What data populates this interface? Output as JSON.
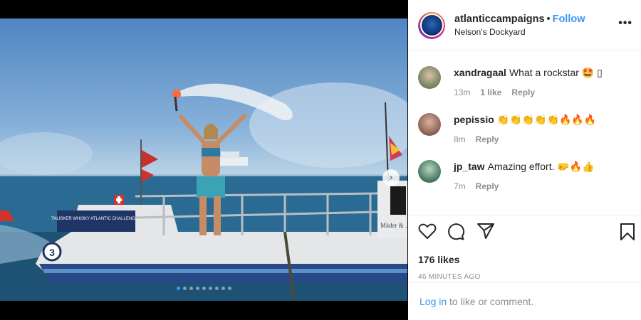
{
  "post": {
    "username": "atlanticcampaigns",
    "separator": "•",
    "follow_label": "Follow",
    "location": "Nelson's Dockyard",
    "more_label": "•••"
  },
  "media": {
    "boat_number": "3",
    "boat_text_left": "TALISKER WHISKY ATLANTIC CHALLENGE",
    "boat_text_right": "Mäder & ...",
    "carousel_next_icon": "chevron-right-icon",
    "slide_count": 9,
    "active_slide": 1
  },
  "comments": [
    {
      "user": "xandragaal",
      "text": "What a rockstar 🤩 ▯",
      "age": "13m",
      "likes": "1 like",
      "reply": "Reply"
    },
    {
      "user": "pepissio",
      "text": "👏👏👏👏👏🔥🔥🔥",
      "age": "8m",
      "reply": "Reply"
    },
    {
      "user": "jp_taw",
      "text": "Amazing effort. 🤛🔥👍",
      "age": "7m",
      "reply": "Reply"
    }
  ],
  "actions": {
    "like_icon": "heart-icon",
    "comment_icon": "comment-icon",
    "share_icon": "share-icon",
    "save_icon": "bookmark-icon"
  },
  "likes_count": "176 likes",
  "posted_time": "46 MINUTES AGO",
  "login": {
    "link": "Log in",
    "rest": " to like or comment."
  },
  "colors": {
    "link": "#3897f0",
    "muted": "#8e8e8e",
    "text": "#262626"
  }
}
